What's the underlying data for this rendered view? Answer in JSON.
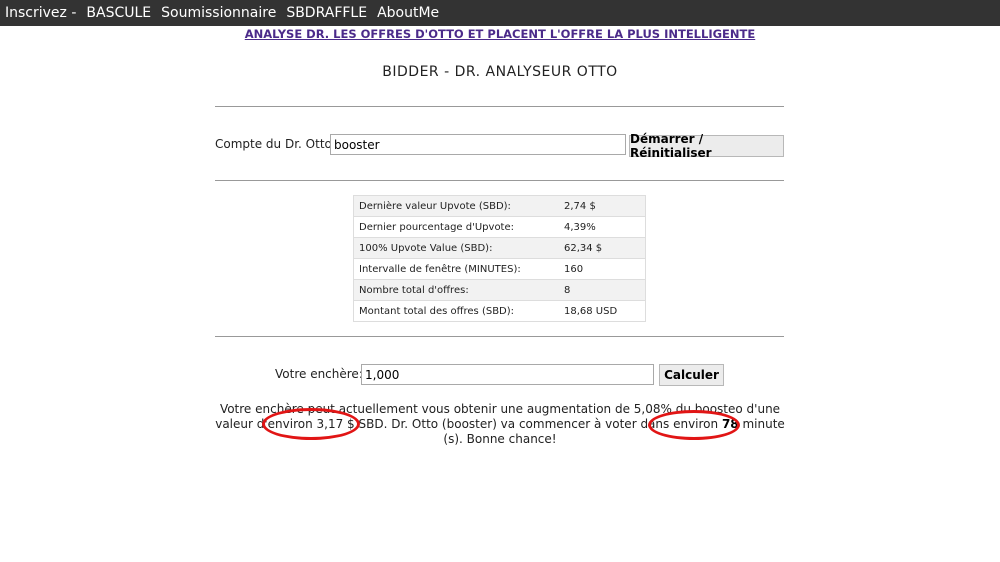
{
  "nav": {
    "items": [
      "Inscrivez -",
      "BASCULE",
      "Soumissionnaire",
      "SBDRAFFLE",
      "AboutMe"
    ]
  },
  "header": {
    "link": "ANALYSE DR. LES OFFRES D'OTTO ET PLACENT L'OFFRE LA PLUS INTELLIGENTE",
    "title": "BIDDER - DR. ANALYSEUR OTTO"
  },
  "account": {
    "label": "Compte du Dr. Otto",
    "value": "booster",
    "button": "Démarrer / Réinitialiser"
  },
  "stats": [
    {
      "label": "Dernière valeur Upvote (SBD):",
      "value": "2,74 $"
    },
    {
      "label": "Dernier pourcentage d'Upvote:",
      "value": "4,39%"
    },
    {
      "label": "100% Upvote Value (SBD):",
      "value": "62,34 $"
    },
    {
      "label": "Intervalle de fenêtre (MINUTES):",
      "value": "160"
    },
    {
      "label": "Nombre total d'offres:",
      "value": "8"
    },
    {
      "label": "Montant total des offres (SBD):",
      "value": "18,68 USD"
    }
  ],
  "bid": {
    "label": "Votre enchère:",
    "value": "1,000",
    "button": "Calculer"
  },
  "result": {
    "part1": "Votre enchère peut actuellement vous obtenir une augmentation de 5,08% du boosteo d'une valeur d'environ ",
    "amount": "3,17 $ SBD.",
    "part2": " Dr. Otto (booster) va commencer à voter dans environ ",
    "minutes": "78",
    "part3": " minute (s). Bonne chance!"
  },
  "colors": {
    "nav_bg": "#333333",
    "link": "#4b2a8a",
    "annotation": "#e11515"
  }
}
